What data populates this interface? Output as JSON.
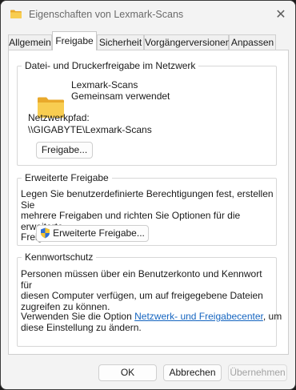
{
  "window": {
    "title": "Eigenschaften von Lexmark-Scans",
    "close_glyph": "✕"
  },
  "tabs": [
    {
      "label": "Allgemein"
    },
    {
      "label": "Freigabe",
      "active": true
    },
    {
      "label": "Sicherheit"
    },
    {
      "label": "Vorgängerversionen"
    },
    {
      "label": "Anpassen"
    }
  ],
  "network_sharing": {
    "title": "Datei- und Druckerfreigabe im Netzwerk",
    "folder_name": "Lexmark-Scans",
    "status": "Gemeinsam verwendet",
    "path_label": "Netzwerkpfad:",
    "path": "\\\\GIGABYTE\\Lexmark-Scans",
    "share_button": "Freigabe..."
  },
  "advanced_sharing": {
    "title": "Erweiterte Freigabe",
    "description_lines": [
      "Legen Sie benutzerdefinierte Berechtigungen fest, erstellen Sie",
      "mehrere Freigaben und richten Sie Optionen für die erweiterte",
      "Freigabe ein."
    ],
    "button": "Erweiterte Freigabe...",
    "button_icon": "uac-shield-icon"
  },
  "password_protection": {
    "title": "Kennwortschutz",
    "description_lines": [
      "Personen müssen über ein Benutzerkonto und Kennwort für",
      "diesen Computer verfügen, um auf freigegebene Dateien",
      "zugreifen zu können."
    ],
    "change_prefix": "Verwenden Sie die Option ",
    "change_link": "Netzwerk- und Freigabecenter",
    "change_suffix": ", um",
    "change_line2": "diese Einstellung zu ändern."
  },
  "footer": {
    "ok": "OK",
    "cancel": "Abbrechen",
    "apply": "Übernehmen"
  },
  "colors": {
    "folder": "#f5c344",
    "link": "#1565c0",
    "shield_blue": "#2f6fd6",
    "shield_yellow": "#f4c430"
  }
}
